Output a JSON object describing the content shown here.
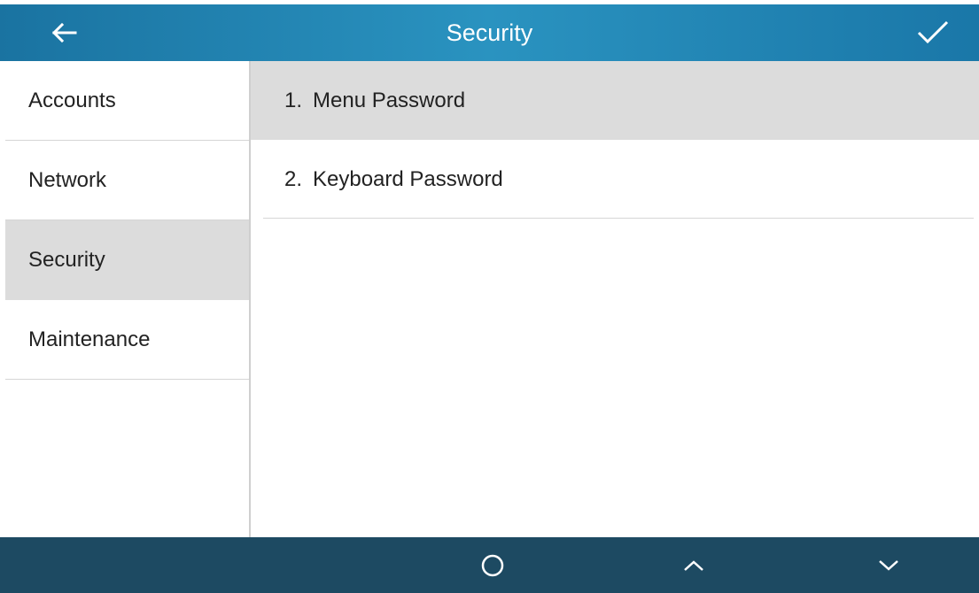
{
  "header": {
    "title": "Security",
    "back_icon": "arrow-left-icon",
    "confirm_icon": "checkmark-icon",
    "color_start": "#1a73a1",
    "color_end": "#2a93c0"
  },
  "sidebar": {
    "items": [
      {
        "label": "Accounts",
        "selected": false
      },
      {
        "label": "Network",
        "selected": false
      },
      {
        "label": "Security",
        "selected": true
      },
      {
        "label": "Maintenance",
        "selected": false
      }
    ]
  },
  "main": {
    "items": [
      {
        "number": "1.",
        "label": "Menu Password",
        "selected": true
      },
      {
        "number": "2.",
        "label": "Keyboard Password",
        "selected": false
      }
    ]
  },
  "bottom_bar": {
    "color": "#1d4a62",
    "keys": [
      {
        "icon": "circle-icon"
      },
      {
        "icon": "chevron-up-icon"
      },
      {
        "icon": "chevron-down-icon"
      }
    ]
  },
  "colors": {
    "selected_background": "#dcdcdc",
    "divider": "#d6d6d6",
    "text": "#222222"
  }
}
